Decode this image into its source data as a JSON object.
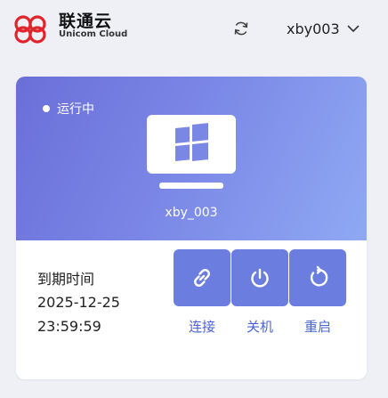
{
  "header": {
    "brand_cn": "联通云",
    "brand_en": "Unicom Cloud",
    "username": "xby003",
    "brand_color": "#e0242b",
    "icons": {
      "logo": "unicom-logo-icon",
      "refresh": "refresh-icon",
      "dropdown": "chevron-down-icon"
    }
  },
  "vm": {
    "status": "运行中",
    "name": "xby_003",
    "os_icon": "windows-monitor-icon",
    "expire_label": "到期时间",
    "expire_date": "2025-12-25",
    "expire_time": "23:59:59"
  },
  "actions": [
    {
      "label": "连接",
      "icon": "link-icon"
    },
    {
      "label": "关机",
      "icon": "power-icon"
    },
    {
      "label": "重启",
      "icon": "restart-icon"
    }
  ],
  "colors": {
    "accent": "#6b7ee0",
    "label": "#4a63d6",
    "gradient_start": "#6a6fd8",
    "gradient_end": "#8fa9f3"
  }
}
